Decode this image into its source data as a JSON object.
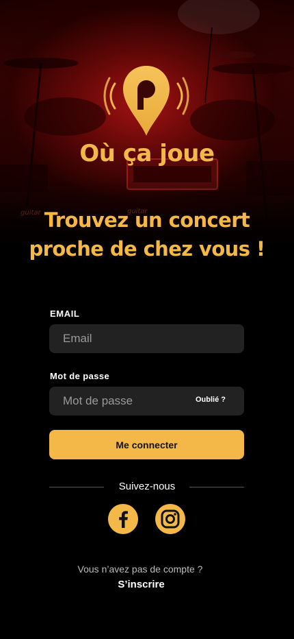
{
  "brand": {
    "name": "Où ça joue",
    "logo_icon": "map-pin-broadcast-icon"
  },
  "headline": {
    "line1": "Trouvez un concert",
    "line2": "proche de chez vous !"
  },
  "form": {
    "email_label": "EMAIL",
    "email_placeholder": "Email",
    "password_label": "Mot de passe",
    "password_placeholder": "Mot de passe",
    "forgot_label": "Oublié ?",
    "submit_label": "Me connecter"
  },
  "social": {
    "title": "Suivez-nous",
    "networks": [
      "facebook-icon",
      "instagram-icon"
    ]
  },
  "footer": {
    "no_account_text": "Vous n’avez pas de compte ?",
    "signup_label": "S’inscrire"
  },
  "colors": {
    "accent": "#f3b847",
    "background": "#000000",
    "field_bg": "#222222",
    "hero_red": "#8a0a0a"
  }
}
